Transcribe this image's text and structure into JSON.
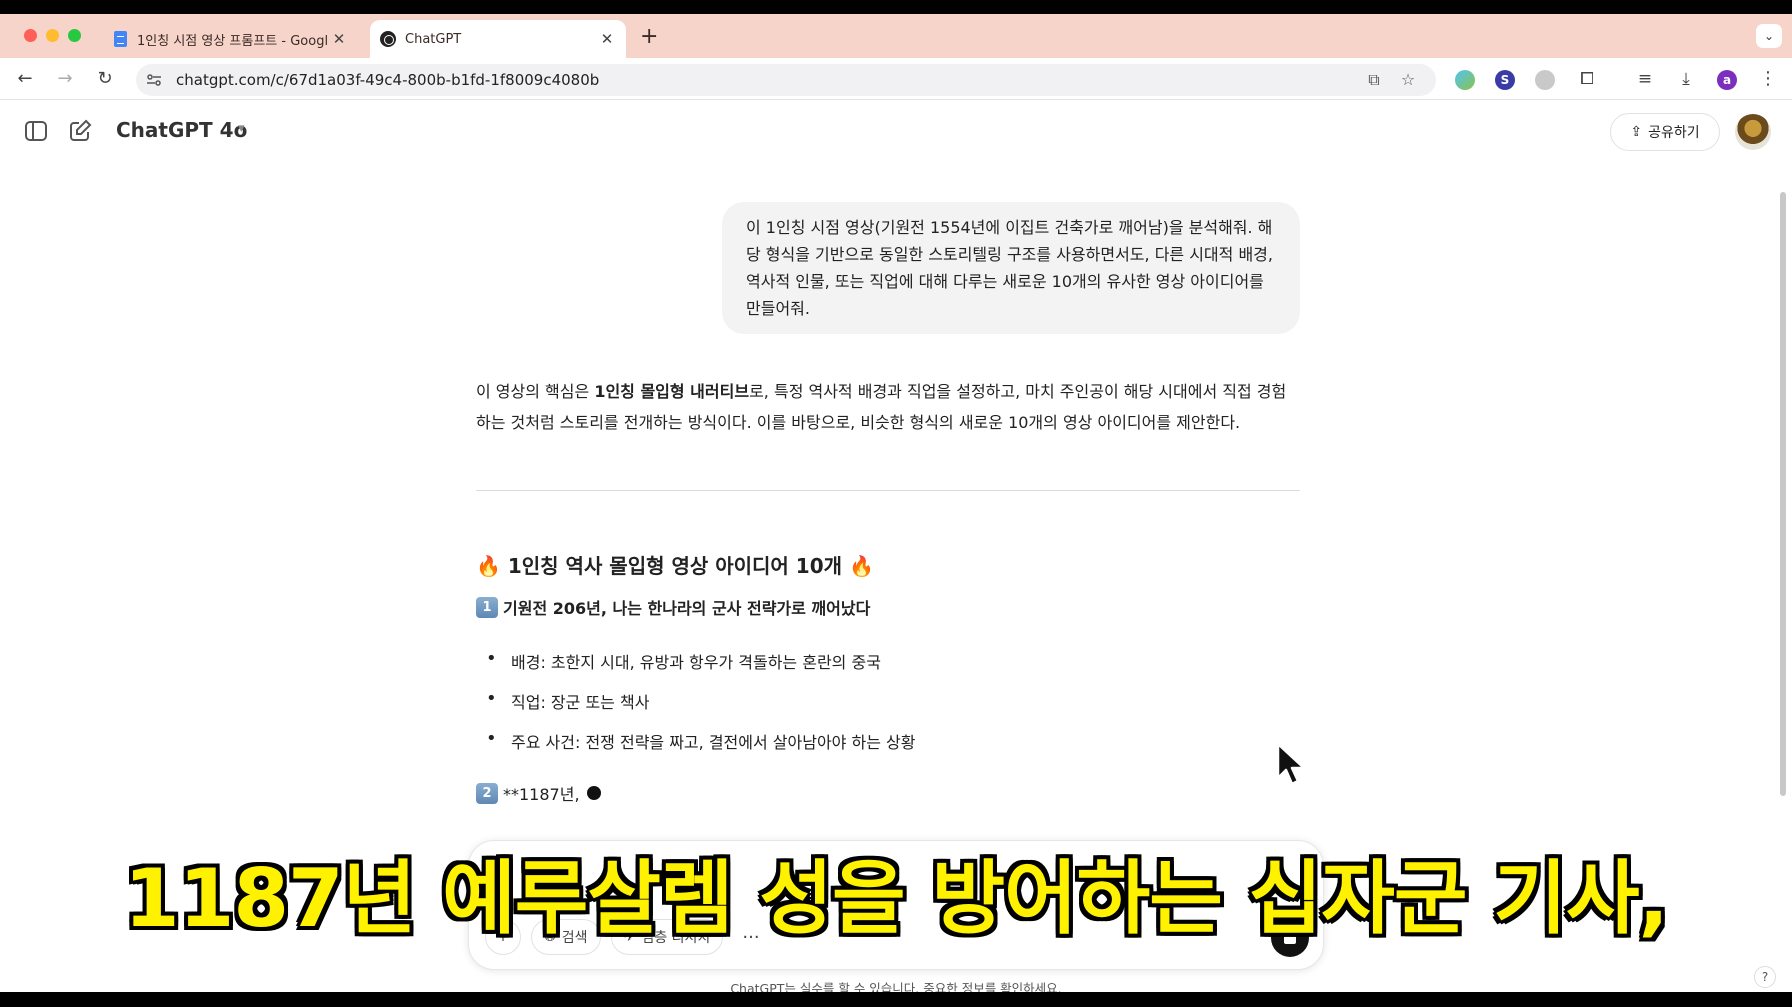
{
  "browser": {
    "tabs": [
      {
        "title": "1인칭 시점 영상 프롬프트 - Googl",
        "icon": "google-docs-icon",
        "active": false
      },
      {
        "title": "ChatGPT",
        "icon": "chatgpt-icon",
        "active": true
      }
    ],
    "url": "chatgpt.com/c/67d1a03f-49c4-800b-b1fd-1f8009c4080b",
    "profile_initial": "a"
  },
  "app": {
    "model": "ChatGPT 4o",
    "share_label": "공유하기"
  },
  "conversation": {
    "user_message": "이 1인칭 시점 영상(기원전 1554년에 이집트 건축가로 깨어남)을 분석해줘. 해당 형식을 기반으로 동일한 스토리텔링 구조를 사용하면서도, 다른 시대적 배경, 역사적 인물, 또는 직업에 대해 다루는 새로운 10개의 유사한 영상 아이디어를 만들어줘.",
    "intro": {
      "before": "이 영상의 핵심은 ",
      "bold": "1인칭 몰입형 내러티브",
      "after": "로, 특정 역사적 배경과 직업을 설정하고, 마치 주인공이 해당 시대에서 직접 경험하는 것처럼 스토리를 전개하는 방식이다. 이를 바탕으로, 비슷한 형식의 새로운 10개의 영상 아이디어를 제안한다."
    },
    "heading": "🔥 1인칭 역사 몰입형 영상 아이디어 10개 🔥",
    "item1": {
      "number": "1",
      "title": "기원전 206년, 나는 한나라의 군사 전략가로 깨어났다",
      "bullets": [
        "배경: 초한지 시대, 유방과 항우가 격돌하는 혼란의 중국",
        "직업: 장군 또는 책사",
        "주요 사건: 전쟁 전략을 짜고, 결전에서 살아남아야 하는 상황"
      ]
    },
    "item2": {
      "number": "2",
      "partial": "**1187년,"
    }
  },
  "composer": {
    "search_label": "검색",
    "research_label": "심층 리서치",
    "disclaimer": "ChatGPT는 실수를 할 수 있습니다. 중요한 정보를 확인하세요."
  },
  "overlay": {
    "subtitle": "1187년 예루살렘 성을 방어하는 십자군 기사,"
  }
}
